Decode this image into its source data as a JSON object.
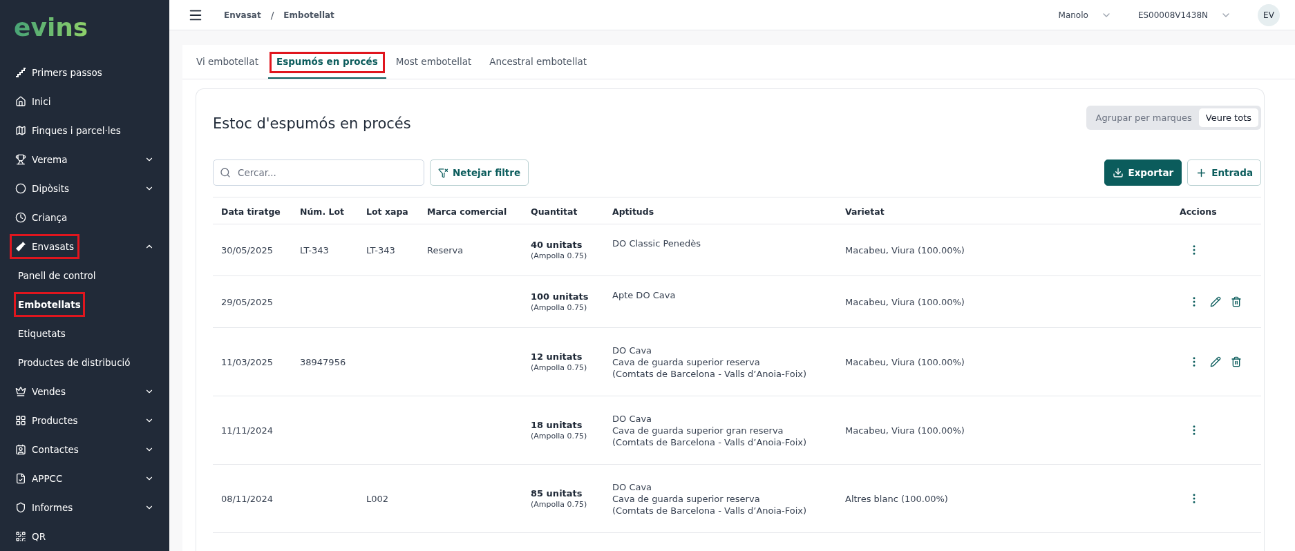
{
  "sidebar": {
    "logo": "evins",
    "items": [
      {
        "label": "Primers passos",
        "kind": "link",
        "highlighted": false
      },
      {
        "label": "Inici",
        "kind": "link",
        "highlighted": false
      },
      {
        "label": "Finques i parcel·les",
        "kind": "link",
        "highlighted": false
      },
      {
        "label": "Verema",
        "kind": "group",
        "expanded": false,
        "highlighted": false
      },
      {
        "label": "Dipòsits",
        "kind": "group",
        "expanded": false,
        "highlighted": false
      },
      {
        "label": "Criança",
        "kind": "link",
        "highlighted": false
      },
      {
        "label": "Envasats",
        "kind": "group",
        "expanded": true,
        "highlighted": true,
        "children": [
          {
            "label": "Panell de control",
            "selected": false,
            "highlighted": false
          },
          {
            "label": "Embotellats",
            "selected": true,
            "highlighted": true
          },
          {
            "label": "Etiquetats",
            "selected": false,
            "highlighted": false
          },
          {
            "label": "Productes de distribució",
            "selected": false,
            "highlighted": false
          }
        ]
      },
      {
        "label": "Vendes",
        "kind": "group",
        "expanded": false,
        "highlighted": false
      },
      {
        "label": "Productes",
        "kind": "group",
        "expanded": false,
        "highlighted": false
      },
      {
        "label": "Contactes",
        "kind": "group",
        "expanded": false,
        "highlighted": false
      },
      {
        "label": "APPCC",
        "kind": "group",
        "expanded": false,
        "highlighted": false
      },
      {
        "label": "Informes",
        "kind": "group",
        "expanded": false,
        "highlighted": false
      },
      {
        "label": "QR",
        "kind": "link",
        "highlighted": false
      }
    ]
  },
  "topbar": {
    "breadcrumb": [
      "Envasat",
      "Embotellat"
    ],
    "breadcrumb_separator": "/",
    "user": "Manolo",
    "account": "ES00008V1438N",
    "avatar": "EV"
  },
  "tabs": [
    {
      "label": "Vi embotellat",
      "selected": false,
      "highlighted": false
    },
    {
      "label": "Espumós en procés",
      "selected": true,
      "highlighted": true
    },
    {
      "label": "Most embotellat",
      "selected": false,
      "highlighted": false
    },
    {
      "label": "Ancestral embotellat",
      "selected": false,
      "highlighted": false
    }
  ],
  "card": {
    "title": "Estoc d'espumós en procés",
    "view_toggle": [
      {
        "label": "Agrupar per marques",
        "selected": false
      },
      {
        "label": "Veure tots",
        "selected": true
      }
    ],
    "search": {
      "placeholder": "Cercar..."
    },
    "filter_button": "Netejar filtre",
    "export_button": "Exportar",
    "add_button": "Entrada"
  },
  "table": {
    "columns": [
      "Data tiratge",
      "Núm. Lot",
      "Lot xapa",
      "Marca comercial",
      "Quantitat",
      "Aptituds",
      "Varietat",
      "Accions"
    ],
    "rows": [
      {
        "date": "30/05/2025",
        "lot": "LT-343",
        "cap_lot": "LT-343",
        "brand": "Reserva",
        "quantity": "40 unitats",
        "package": "(Ampolla 0.75)",
        "aptitudes": [
          "DO Classic Penedès"
        ],
        "variety": "Macabeu, Viura (100.00%)",
        "editable": false
      },
      {
        "date": "29/05/2025",
        "lot": "",
        "cap_lot": "",
        "brand": "",
        "quantity": "100 unitats",
        "package": "(Ampolla 0.75)",
        "aptitudes": [
          "Apte DO Cava"
        ],
        "variety": "Macabeu, Viura (100.00%)",
        "editable": true
      },
      {
        "date": "11/03/2025",
        "lot": "38947956",
        "cap_lot": "",
        "brand": "",
        "quantity": "12 unitats",
        "package": "(Ampolla 0.75)",
        "aptitudes": [
          "DO Cava",
          "Cava de guarda superior reserva",
          "(Comtats de Barcelona - Valls d’Anoia-Foix)"
        ],
        "variety": "Macabeu, Viura (100.00%)",
        "editable": true
      },
      {
        "date": "11/11/2024",
        "lot": "",
        "cap_lot": "",
        "brand": "",
        "quantity": "18 unitats",
        "package": "(Ampolla 0.75)",
        "aptitudes": [
          "DO Cava",
          "Cava de guarda superior gran reserva",
          "(Comtats de Barcelona - Valls d’Anoia-Foix)"
        ],
        "variety": "Macabeu, Viura (100.00%)",
        "editable": false
      },
      {
        "date": "08/11/2024",
        "lot": "",
        "cap_lot": "L002",
        "brand": "",
        "quantity": "85 unitats",
        "package": "(Ampolla 0.75)",
        "aptitudes": [
          "DO Cava",
          "Cava de guarda superior reserva",
          "(Comtats de Barcelona - Valls d’Anoia-Foix)"
        ],
        "variety": "Altres blanc (100.00%)",
        "editable": false
      }
    ]
  }
}
